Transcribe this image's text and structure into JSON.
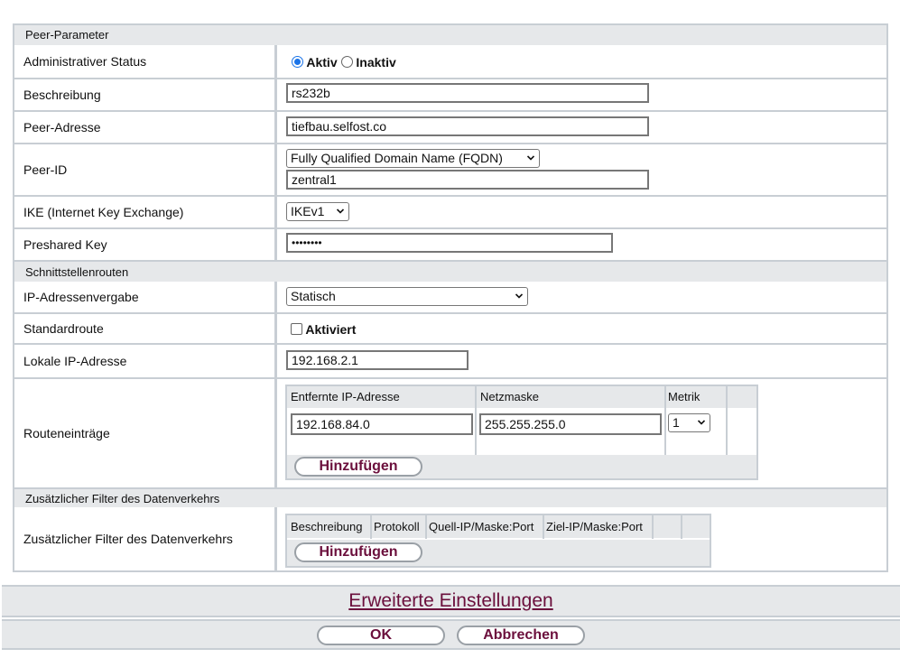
{
  "sections": {
    "peer": "Peer-Parameter",
    "routes": "Schnittstellenrouten",
    "filter": "Zusätzlicher Filter des Datenverkehrs"
  },
  "fields": {
    "admin_status": {
      "label": "Administrativer Status",
      "option_active": "Aktiv",
      "option_inactive": "Inaktiv",
      "selected": "Aktiv"
    },
    "description": {
      "label": "Beschreibung",
      "value": "rs232b"
    },
    "peer_address": {
      "label": "Peer-Adresse",
      "value": "tiefbau.selfost.co"
    },
    "peer_id": {
      "label": "Peer-ID",
      "type_value": "Fully Qualified Domain Name (FQDN)",
      "value": "zentral1"
    },
    "ike": {
      "label": "IKE (Internet Key Exchange)",
      "value": "IKEv1"
    },
    "psk": {
      "label": "Preshared Key",
      "value": "••••••••"
    },
    "ip_assignment": {
      "label": "IP-Adressenvergabe",
      "value": "Statisch"
    },
    "default_route": {
      "label": "Standardroute",
      "checkbox_label": "Aktiviert",
      "checked": false
    },
    "local_ip": {
      "label": "Lokale IP-Adresse",
      "value": "192.168.2.1"
    },
    "route_entries": {
      "label": "Routeneinträge",
      "headers": [
        "Entfernte IP-Adresse",
        "Netzmaske",
        "Metrik"
      ],
      "row": {
        "remote_ip": "192.168.84.0",
        "netmask": "255.255.255.0",
        "metric": "1"
      },
      "add_label": "Hinzufügen"
    },
    "traffic_filter": {
      "label": "Zusätzlicher Filter des Datenverkehrs",
      "headers": [
        "Beschreibung",
        "Protokoll",
        "Quell-IP/Maske:Port",
        "Ziel-IP/Maske:Port"
      ],
      "add_label": "Hinzufügen"
    }
  },
  "footer": {
    "advanced_link": "Erweiterte Einstellungen",
    "ok": "OK",
    "cancel": "Abbrechen"
  },
  "colors": {
    "accent": "#6b0f3c",
    "border": "#c8ced4",
    "section_bg": "#e6e8ea"
  },
  "icons": [
    "chevron-down-icon"
  ]
}
